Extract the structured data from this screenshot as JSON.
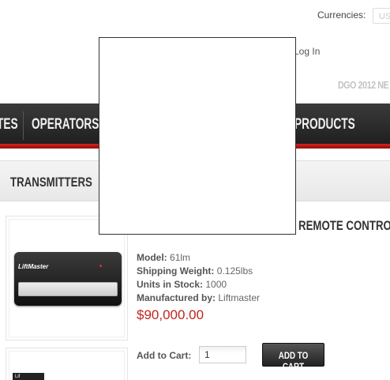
{
  "header": {
    "currencies_label": "Currencies:",
    "currency_value": "US",
    "login": "Log In",
    "promo": "DGO 2012 NE"
  },
  "nav": {
    "items": [
      "TES",
      "OPERATORS",
      "PRODUCTS"
    ]
  },
  "breadcrumb": {
    "current": "TRANSMITTERS"
  },
  "product": {
    "title": "REMOTE CONTROL",
    "brand_on_image": "LiftMaster",
    "model_label": "Model:",
    "model_value": "61lm",
    "weight_label": "Shipping Weight:",
    "weight_value": "0.125lbs",
    "stock_label": "Units in Stock:",
    "stock_value": "1000",
    "manufacturer_label": "Manufactured by:",
    "manufacturer_value": "Liftmaster",
    "price": "$90,000.00",
    "thumb2_label": "Lif"
  },
  "cart": {
    "label": "Add to Cart:",
    "qty": "1",
    "button": "ADD TO CART"
  },
  "colors": {
    "accent_red": "#d8221e",
    "nav_dark": "#2a2a2a",
    "price": "#c0241f"
  }
}
